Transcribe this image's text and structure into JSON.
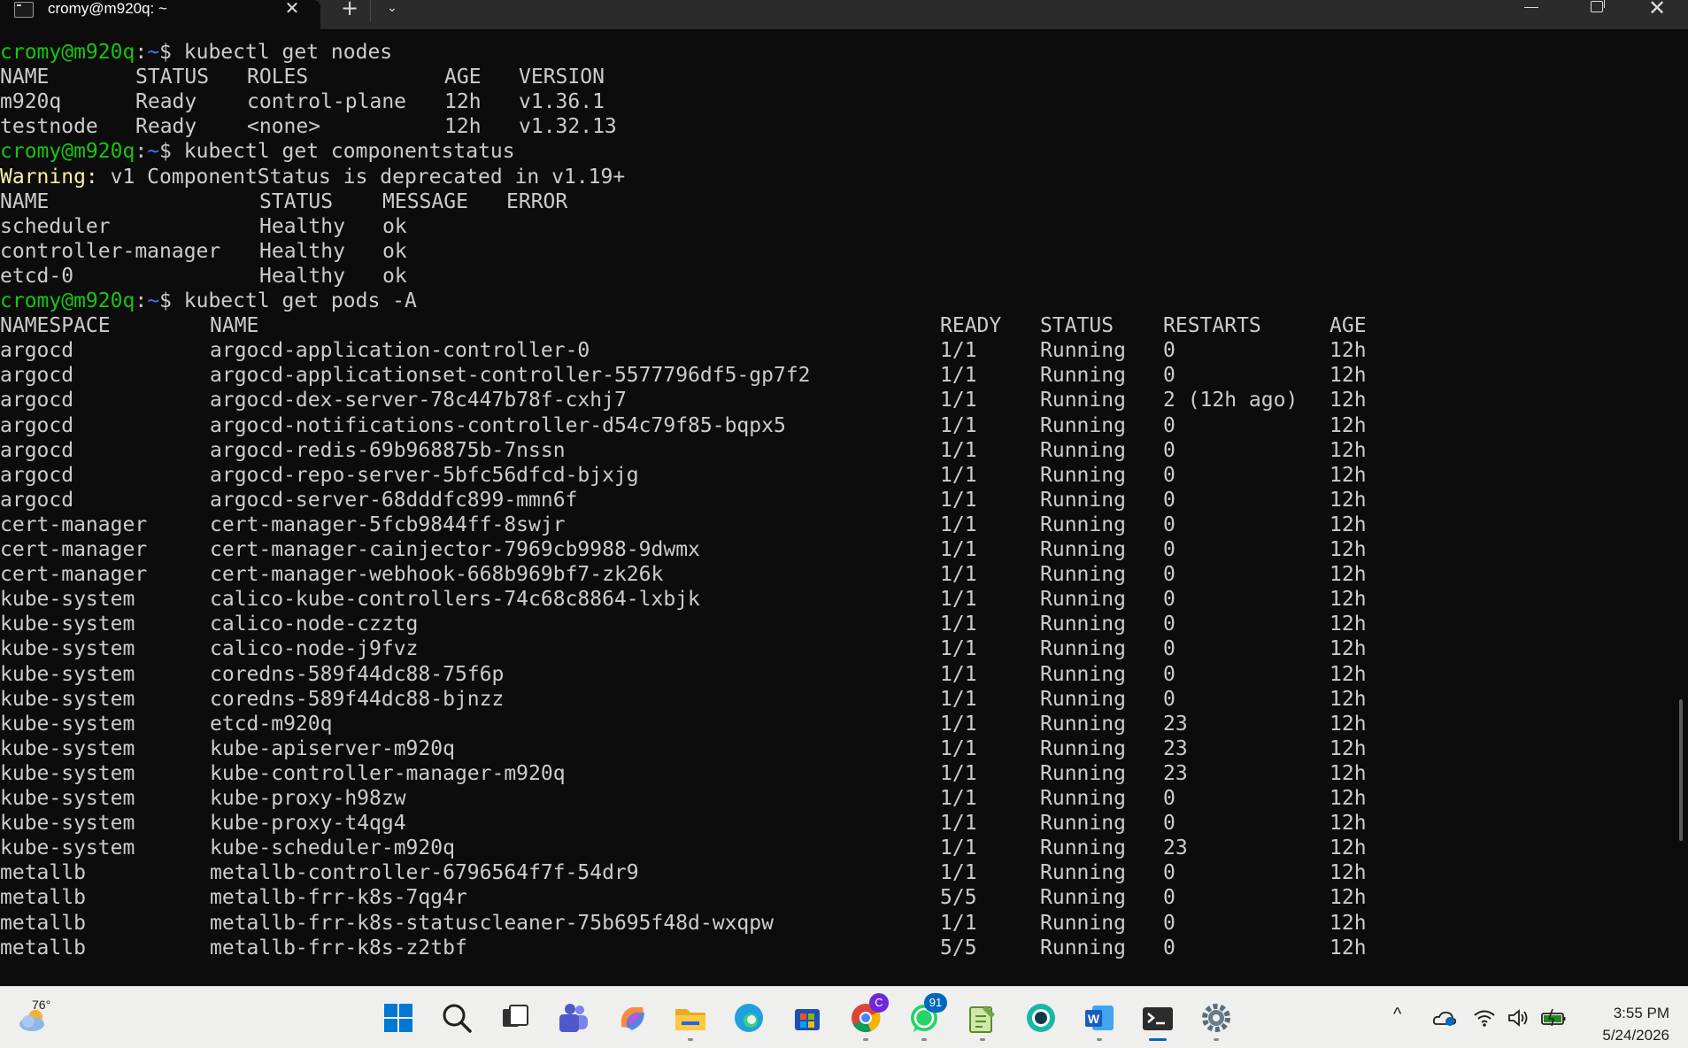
{
  "window": {
    "tab_title": "cromy@m920q: ~",
    "tab_close": "✕",
    "new_tab": "+",
    "dropdown": "⌄",
    "close": "✕"
  },
  "prompt": {
    "user_host": "cromy@m920q",
    "colon": ":",
    "path": "~",
    "dollar": "$"
  },
  "commands": {
    "get_nodes": "kubectl get nodes",
    "get_componentstatus": "kubectl get componentstatus",
    "get_pods": "kubectl get pods -A"
  },
  "nodes": {
    "headers": [
      "NAME",
      "STATUS",
      "ROLES",
      "AGE",
      "VERSION"
    ],
    "rows": [
      [
        "m920q",
        "Ready",
        "control-plane",
        "12h",
        "v1.36.1"
      ],
      [
        "testnode",
        "Ready",
        "<none>",
        "12h",
        "v1.32.13"
      ]
    ]
  },
  "componentstatus": {
    "warning_label": "Warning:",
    "warning_text": " v1 ComponentStatus is deprecated in v1.19+",
    "headers": [
      "NAME",
      "STATUS",
      "MESSAGE",
      "ERROR"
    ],
    "rows": [
      [
        "scheduler",
        "Healthy",
        "ok",
        ""
      ],
      [
        "controller-manager",
        "Healthy",
        "ok",
        ""
      ],
      [
        "etcd-0",
        "Healthy",
        "ok",
        ""
      ]
    ]
  },
  "pods": {
    "headers": [
      "NAMESPACE",
      "NAME",
      "READY",
      "STATUS",
      "RESTARTS",
      "AGE"
    ],
    "rows": [
      [
        "argocd",
        "argocd-application-controller-0",
        "1/1",
        "Running",
        "0",
        "12h"
      ],
      [
        "argocd",
        "argocd-applicationset-controller-5577796df5-gp7f2",
        "1/1",
        "Running",
        "0",
        "12h"
      ],
      [
        "argocd",
        "argocd-dex-server-78c447b78f-cxhj7",
        "1/1",
        "Running",
        "2 (12h ago)",
        "12h"
      ],
      [
        "argocd",
        "argocd-notifications-controller-d54c79f85-bqpx5",
        "1/1",
        "Running",
        "0",
        "12h"
      ],
      [
        "argocd",
        "argocd-redis-69b968875b-7nssn",
        "1/1",
        "Running",
        "0",
        "12h"
      ],
      [
        "argocd",
        "argocd-repo-server-5bfc56dfcd-bjxjg",
        "1/1",
        "Running",
        "0",
        "12h"
      ],
      [
        "argocd",
        "argocd-server-68dddfc899-mmn6f",
        "1/1",
        "Running",
        "0",
        "12h"
      ],
      [
        "cert-manager",
        "cert-manager-5fcb9844ff-8swjr",
        "1/1",
        "Running",
        "0",
        "12h"
      ],
      [
        "cert-manager",
        "cert-manager-cainjector-7969cb9988-9dwmx",
        "1/1",
        "Running",
        "0",
        "12h"
      ],
      [
        "cert-manager",
        "cert-manager-webhook-668b969bf7-zk26k",
        "1/1",
        "Running",
        "0",
        "12h"
      ],
      [
        "kube-system",
        "calico-kube-controllers-74c68c8864-lxbjk",
        "1/1",
        "Running",
        "0",
        "12h"
      ],
      [
        "kube-system",
        "calico-node-czztg",
        "1/1",
        "Running",
        "0",
        "12h"
      ],
      [
        "kube-system",
        "calico-node-j9fvz",
        "1/1",
        "Running",
        "0",
        "12h"
      ],
      [
        "kube-system",
        "coredns-589f44dc88-75f6p",
        "1/1",
        "Running",
        "0",
        "12h"
      ],
      [
        "kube-system",
        "coredns-589f44dc88-bjnzz",
        "1/1",
        "Running",
        "0",
        "12h"
      ],
      [
        "kube-system",
        "etcd-m920q",
        "1/1",
        "Running",
        "23",
        "12h"
      ],
      [
        "kube-system",
        "kube-apiserver-m920q",
        "1/1",
        "Running",
        "23",
        "12h"
      ],
      [
        "kube-system",
        "kube-controller-manager-m920q",
        "1/1",
        "Running",
        "23",
        "12h"
      ],
      [
        "kube-system",
        "kube-proxy-h98zw",
        "1/1",
        "Running",
        "0",
        "12h"
      ],
      [
        "kube-system",
        "kube-proxy-t4qg4",
        "1/1",
        "Running",
        "0",
        "12h"
      ],
      [
        "kube-system",
        "kube-scheduler-m920q",
        "1/1",
        "Running",
        "23",
        "12h"
      ],
      [
        "metallb",
        "metallb-controller-6796564f7f-54dr9",
        "1/1",
        "Running",
        "0",
        "12h"
      ],
      [
        "metallb",
        "metallb-frr-k8s-7qg4r",
        "5/5",
        "Running",
        "0",
        "12h"
      ],
      [
        "metallb",
        "metallb-frr-k8s-statuscleaner-75b695f48d-wxqpw",
        "1/1",
        "Running",
        "0",
        "12h"
      ],
      [
        "metallb",
        "metallb-frr-k8s-z2tbf",
        "5/5",
        "Running",
        "0",
        "12h"
      ]
    ]
  },
  "taskbar": {
    "weather_temp": "76°",
    "whatsapp_badge": "91",
    "chrome_badge": "C",
    "tray_overflow": "^",
    "time": "3:55 PM",
    "date": "5/24/2026"
  }
}
